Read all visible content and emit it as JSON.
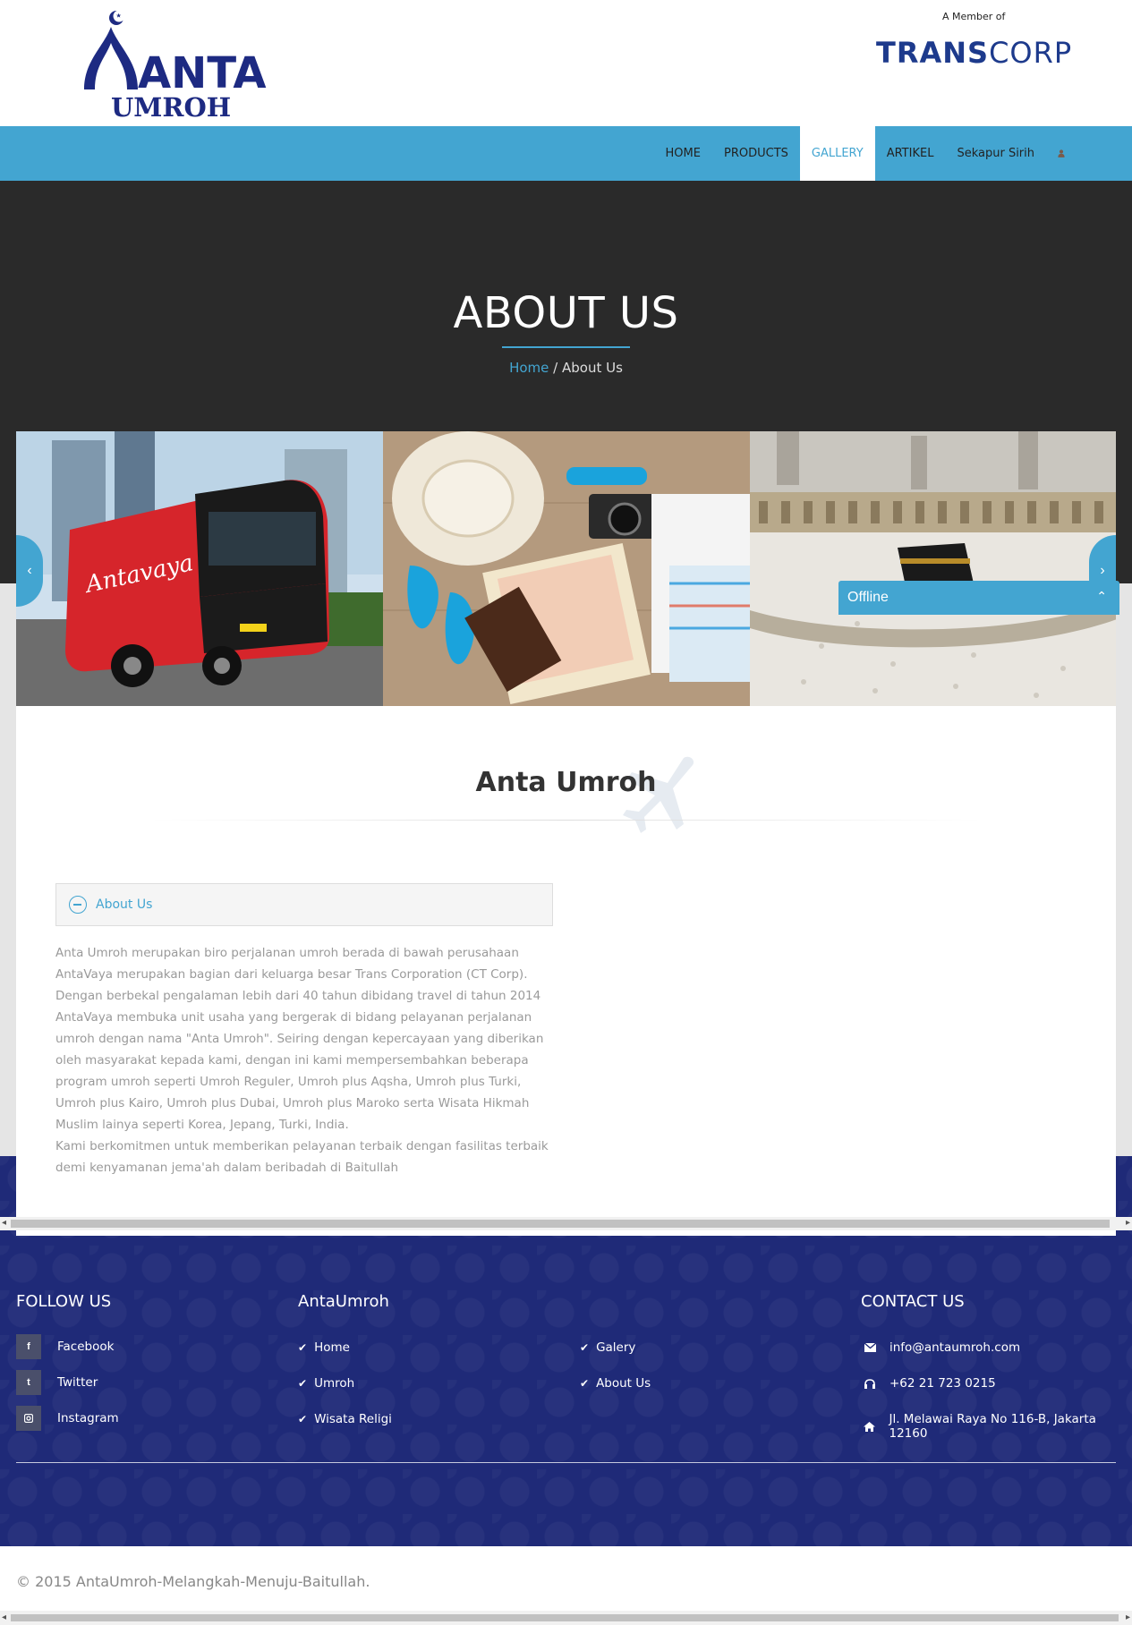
{
  "brand": {
    "logo_top": "ANTA",
    "logo_bottom": "UMROH",
    "member_text": "A Member of",
    "member_brand_bold": "TRANS",
    "member_brand_light": "CORP"
  },
  "nav": {
    "items": [
      {
        "label": "HOME"
      },
      {
        "label": "PRODUCTS"
      },
      {
        "label": "GALLERY",
        "active": true
      },
      {
        "label": "ARTIKEL"
      },
      {
        "label": "Sekapur Sirih"
      }
    ],
    "user_icon": "user-icon"
  },
  "hero": {
    "title": "ABOUT US",
    "breadcrumb_home": "Home",
    "breadcrumb_sep": "/",
    "breadcrumb_current": "About Us"
  },
  "slider": {
    "slides": [
      "bus-photo",
      "travel-items-photo",
      "kaaba-photo"
    ],
    "prev_icon": "chevron-left-icon",
    "next_icon": "chevron-right-icon"
  },
  "chat": {
    "label": "Offline",
    "icon": "chevron-up-icon"
  },
  "content": {
    "title": "Anta Umroh",
    "accordion_label": "About Us",
    "paragraph_1": "Anta Umroh merupakan biro perjalanan umroh berada di bawah perusahaan AntaVaya merupakan bagian dari keluarga besar Trans Corporation (CT Corp). Dengan berbekal pengalaman lebih dari 40 tahun dibidang travel di tahun 2014 AntaVaya membuka unit usaha yang bergerak di bidang pelayanan perjalanan umroh dengan nama \"Anta Umroh\". Seiring dengan kepercayaan yang diberikan oleh masyarakat kepada kami, dengan ini kami mempersembahkan beberapa program umroh seperti Umroh Reguler, Umroh plus Aqsha, Umroh plus Turki, Umroh plus Kairo, Umroh plus Dubai, Umroh plus Maroko serta Wisata Hikmah Muslim lainya seperti Korea, Jepang, Turki, India.",
    "paragraph_2": "Kami berkomitmen untuk memberikan pelayanan terbaik dengan fasilitas terbaik demi kenyamanan jema'ah dalam beribadah di Baitullah"
  },
  "footer": {
    "follow_title": "FOLLOW US",
    "social": [
      {
        "icon": "f",
        "label": "Facebook"
      },
      {
        "icon": "t",
        "label": "Twitter"
      },
      {
        "icon": "ig",
        "label": "Instagram"
      }
    ],
    "links_title": "AntaUmroh",
    "links_col1": [
      "Home",
      "Umroh",
      "Wisata Religi"
    ],
    "links_col2": [
      "Galery",
      "About Us"
    ],
    "contact_title": "CONTACT US",
    "contact": [
      {
        "icon": "envelope-icon",
        "text": "info@antaumroh.com"
      },
      {
        "icon": "headset-icon",
        "text": "+62 21 723 0215"
      },
      {
        "icon": "home-icon",
        "text": "Jl. Melawai Raya No 116-B, Jakarta 12160"
      }
    ]
  },
  "copyright": "© 2015 AntaUmroh-Melangkah-Menuju-Baitullah.",
  "colors": {
    "accent": "#43a5d1",
    "hero_bg": "#2a2a2a",
    "footer_bg": "#1f2a78",
    "logo_navy": "#1d2a82"
  }
}
